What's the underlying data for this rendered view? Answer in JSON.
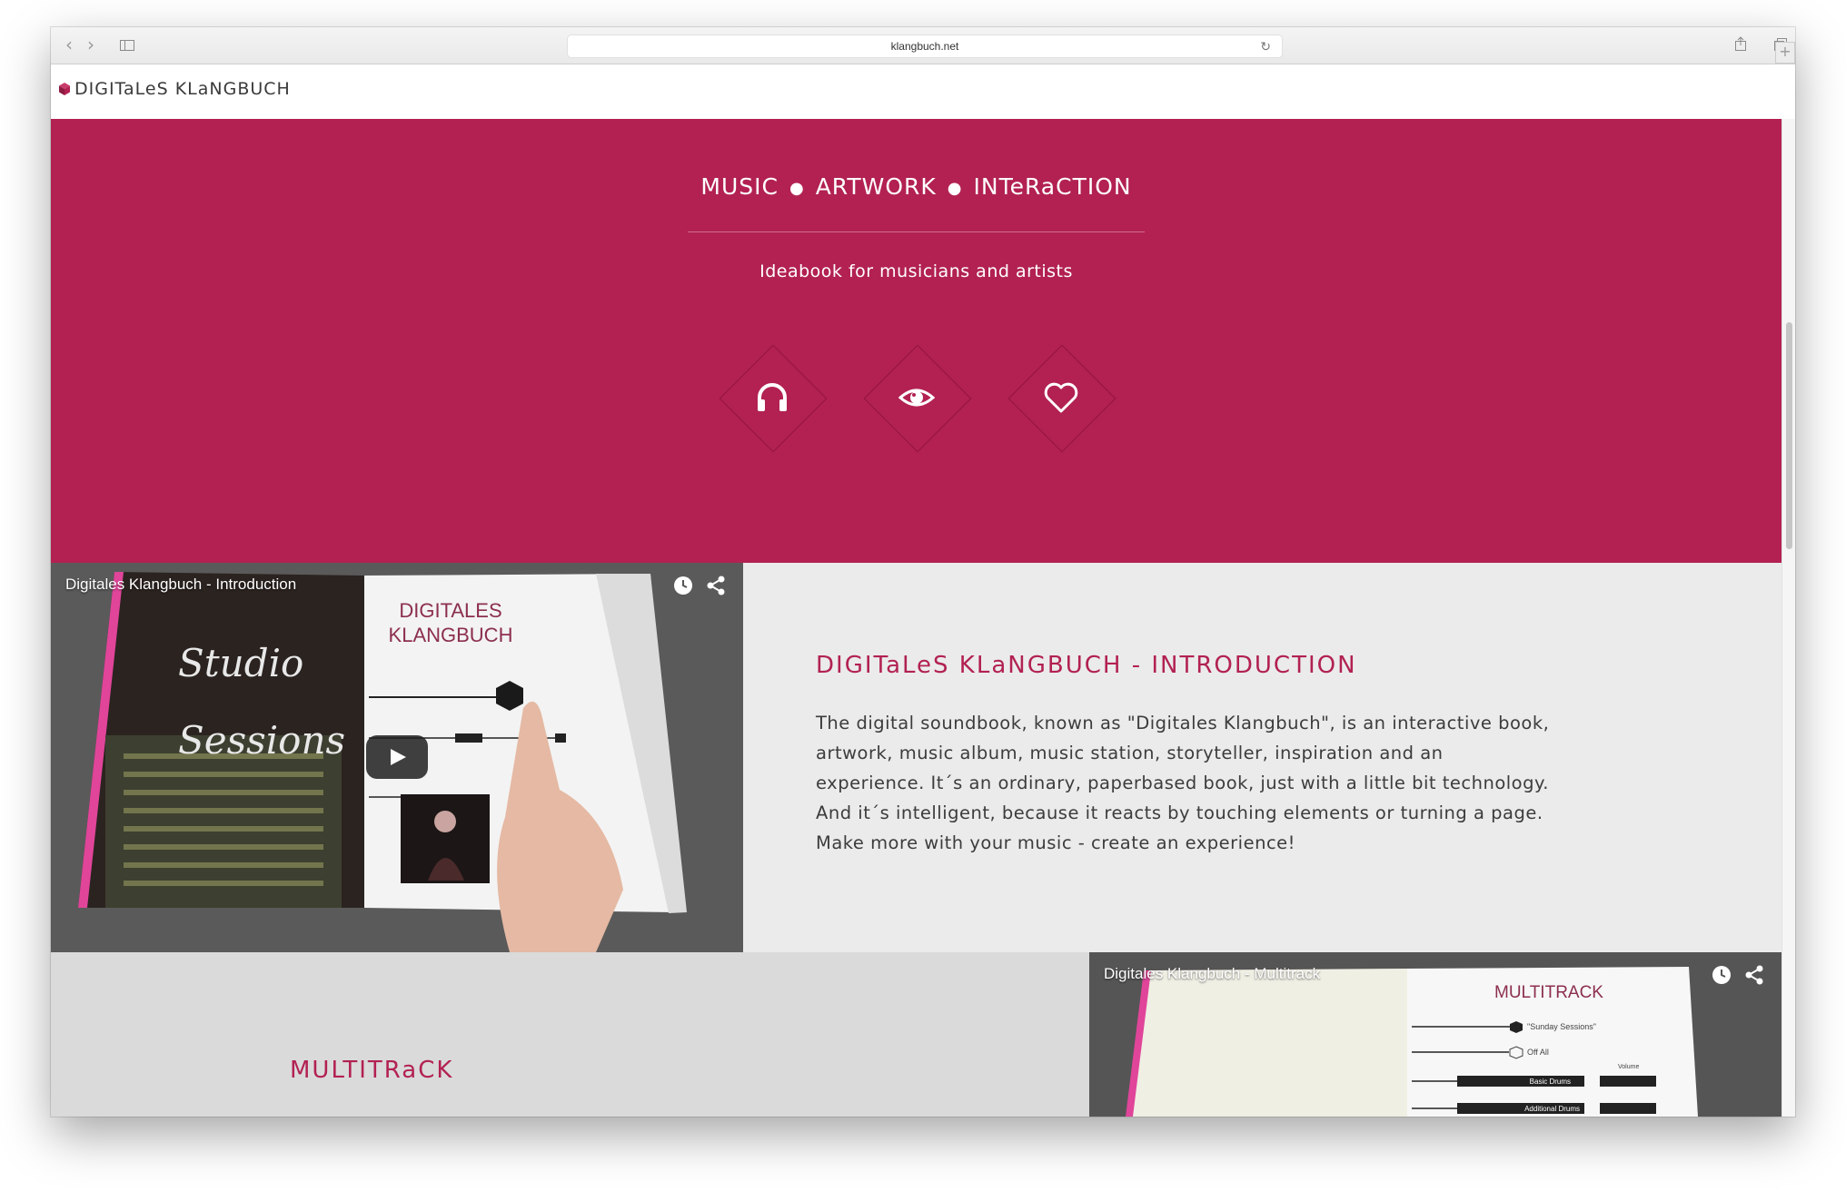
{
  "browser": {
    "url": "klangbuch.net"
  },
  "site": {
    "logo_text": "DIGITaLeS KLaNGBUCH",
    "brand_color": "#b22152"
  },
  "hero": {
    "tagline": [
      "MUSIC",
      "ARTWORK",
      "INTeRaCTION"
    ],
    "subtitle": "Ideabook for musicians and artists",
    "icons": [
      "headphones-icon",
      "eye-icon",
      "heart-icon"
    ]
  },
  "intro": {
    "video_title": "Digitales Klangbuch - Introduction",
    "video_book_title": [
      "DIGITALES",
      "KLANGBUCH"
    ],
    "video_book_script": [
      "Studio",
      "Sessions"
    ],
    "heading": "DIGITaLeS KLaNGBUCH  -  INTRODUCTION",
    "text_lines": [
      "The digital soundbook, known as \"Digitales Klangbuch\", is an interactive book,",
      "artwork, music album, music station, storyteller, inspiration and an",
      "experience. It´s an ordinary, paperbased book, just with a little bit technology.",
      "And it´s intelligent, because it reacts by touching elements or turning a page.",
      "Make more with your music - create an experience!"
    ]
  },
  "multitrack": {
    "heading": "MULTITRaCK",
    "video_title": "Digitales Klangbuch - Multitrack",
    "video_book_title": "MULTITRACK",
    "video_labels": [
      "\"Sunday Sessions\"",
      "Off All",
      "Volume",
      "Basic Drums",
      "Additional Drums"
    ]
  }
}
